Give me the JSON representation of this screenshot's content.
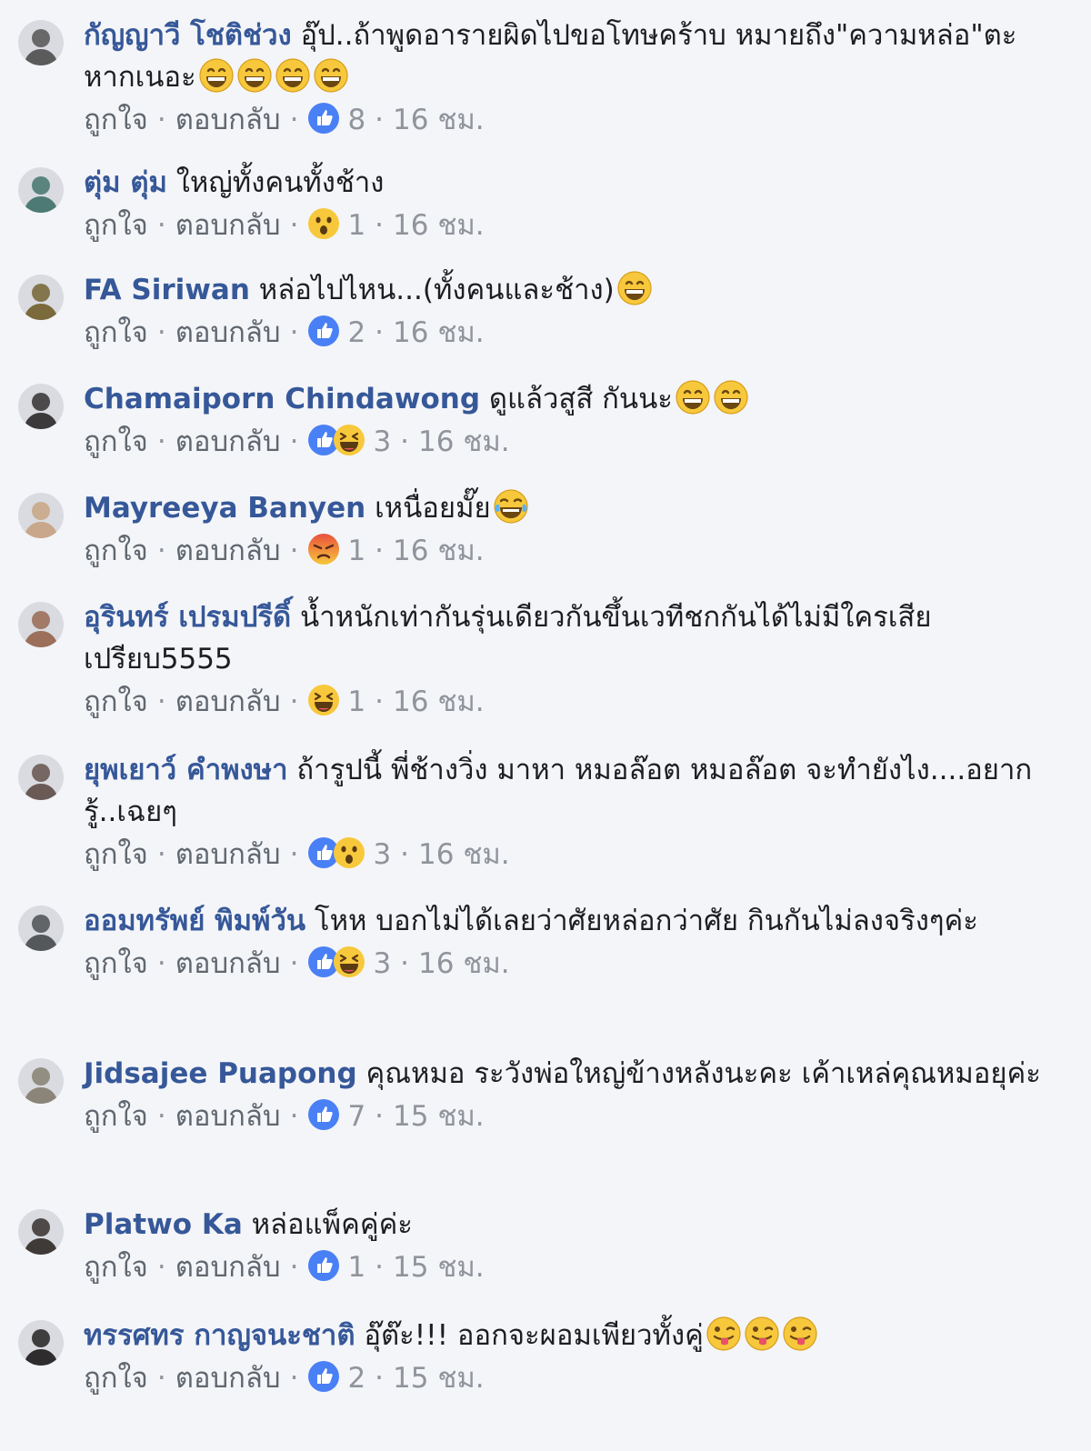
{
  "comments": [
    {
      "author": "กัญญาวี โชติช่วง",
      "text": "อุ๊ป..ถ้าพูดอารายผิดไปขอโทษคร้าบ หมายถึง\"ความหล่อ\"ตะหากเนอะ",
      "trailing_emoji": [
        "grin-emoji",
        "grin-emoji",
        "grin-emoji",
        "grin-emoji"
      ],
      "like": "ถูกใจ",
      "reply": "ตอบกลับ",
      "reactions": [
        "like-reaction"
      ],
      "reaction_count": "8",
      "time": "16 ชม."
    },
    {
      "author": "ตุ่ม ตุ่ม",
      "text": "ใหญ่ทั้งคนทั้งช้าง",
      "trailing_emoji": [],
      "like": "ถูกใจ",
      "reply": "ตอบกลับ",
      "reactions": [
        "wow-reaction"
      ],
      "reaction_count": "1",
      "time": "16 ชม."
    },
    {
      "author": "FA Siriwan",
      "text": "หล่อไปไหน...(ทั้งคนและช้าง)",
      "trailing_emoji": [
        "smile-emoji"
      ],
      "like": "ถูกใจ",
      "reply": "ตอบกลับ",
      "reactions": [
        "like-reaction"
      ],
      "reaction_count": "2",
      "time": "16 ชม."
    },
    {
      "author": "Chamaiporn Chindawong",
      "text": "ดูแล้วสูสี กันนะ",
      "trailing_emoji": [
        "smile-emoji",
        "smile-emoji"
      ],
      "like": "ถูกใจ",
      "reply": "ตอบกลับ",
      "reactions": [
        "like-reaction",
        "haha-reaction"
      ],
      "reaction_count": "3",
      "time": "16 ชม."
    },
    {
      "author": "Mayreeya Banyen",
      "text": "เหนื่อยมั๊ย",
      "trailing_emoji": [
        "tears-joy-emoji"
      ],
      "like": "ถูกใจ",
      "reply": "ตอบกลับ",
      "reactions": [
        "angry-reaction"
      ],
      "reaction_count": "1",
      "time": "16 ชม."
    },
    {
      "author": "อุรินทร์ เปรมปรีดิ์",
      "text": "น้ำหนักเท่ากันรุ่นเดียวกันขึ้นเวทีชกกันได้ไม่มีใครเสียเปรียบ5555",
      "trailing_emoji": [],
      "like": "ถูกใจ",
      "reply": "ตอบกลับ",
      "reactions": [
        "haha-reaction"
      ],
      "reaction_count": "1",
      "time": "16 ชม."
    },
    {
      "author": "ยุพเยาว์ คำพงษา",
      "text": "ถ้ารูปนี้ พี่ช้างวิ่ง มาหา หมอล๊อต หมอล๊อต จะทำยังไง....อยากรู้..เฉยๆ",
      "trailing_emoji": [],
      "like": "ถูกใจ",
      "reply": "ตอบกลับ",
      "reactions": [
        "like-reaction",
        "wow-reaction"
      ],
      "reaction_count": "3",
      "time": "16 ชม."
    },
    {
      "author": "ออมทรัพย์ พิมพ์วัน",
      "text": "โหห บอกไม่ได้เลยว่าศัยหล่อกว่าศัย กินกันไม่ลงจริงๆค่ะ",
      "trailing_emoji": [],
      "like": "ถูกใจ",
      "reply": "ตอบกลับ",
      "reactions": [
        "like-reaction",
        "haha-reaction"
      ],
      "reaction_count": "3",
      "time": "16 ชม."
    },
    {
      "author": "Jidsajee Puapong",
      "text": "คุณหมอ ระวังพ่อใหญ่ข้างหลังนะคะ เค้าเหล่คุณหมอยุค่ะ",
      "trailing_emoji": [],
      "like": "ถูกใจ",
      "reply": "ตอบกลับ",
      "reactions": [
        "like-reaction"
      ],
      "reaction_count": "7",
      "time": "15 ชม."
    },
    {
      "author": "Platwo Ka",
      "text": "หล่อแพ็คคู่ค่ะ",
      "trailing_emoji": [],
      "like": "ถูกใจ",
      "reply": "ตอบกลับ",
      "reactions": [
        "like-reaction"
      ],
      "reaction_count": "1",
      "time": "15 ชม."
    },
    {
      "author": "ทรรศทร กาญจนะชาติ",
      "text": "อุ๊ต๊ะ!!! ออกจะผอมเพียวทั้งคู่",
      "trailing_emoji": [
        "tongue-wink-emoji",
        "tongue-wink-emoji",
        "tongue-wink-emoji"
      ],
      "like": "ถูกใจ",
      "reply": "ตอบกลับ",
      "reactions": [
        "like-reaction"
      ],
      "reaction_count": "2",
      "time": "15 ชม."
    }
  ],
  "colors": {
    "author": "#365899",
    "meta": "#606770",
    "background": "#f4f5f8",
    "like_blue": "#4a80f5",
    "emoji_yellow": "#f7c83b",
    "angry_red": "#e9503d"
  }
}
